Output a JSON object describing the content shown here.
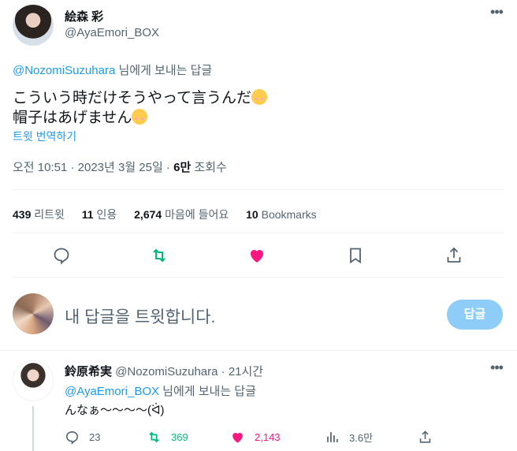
{
  "main_tweet": {
    "display_name": "絵森 彩",
    "handle": "@AyaEmori_BOX",
    "more_icon": "more-horizontal-icon",
    "replying_mention": "@NozomiSuzuhara",
    "replying_suffix": "님에게 보내는 답글",
    "text_line1": "こういう時だけそうやって言うんだ",
    "text_line2": "帽子はあげません",
    "emoji": "smiling-face-icon",
    "translate_label": "트윗 번역하기",
    "timestamp": "오전 10:51 · 2023년 3월 25일 · ",
    "views_count": "6만",
    "views_label": " 조회수"
  },
  "stats": {
    "retweets_count": "439",
    "retweets_label": " 리트윗",
    "quotes_count": "11",
    "quotes_label": " 인용",
    "likes_count": "2,674",
    "likes_label": " 마음에 들어요",
    "bookmarks_count": "10",
    "bookmarks_label": " Bookmarks"
  },
  "actions": {
    "reply_icon": "reply-icon",
    "retweet_icon": "retweet-icon",
    "like_icon": "heart-filled-icon",
    "bookmark_icon": "bookmark-icon",
    "share_icon": "share-icon"
  },
  "compose": {
    "placeholder": "내 답글을 트윗합니다.",
    "reply_button": "답글"
  },
  "reply_tweet": {
    "display_name": "鈴原希実",
    "handle": "@NozomiSuzuhara",
    "time": " · 21시간",
    "replying_mention": "@AyaEmori_BOX",
    "replying_suffix": "님에게 보내는 답글",
    "text": "んなぁ〜〜〜〜(ᐛ)",
    "reply_count": "23",
    "retweet_count": "369",
    "like_count": "2,143",
    "views_count": "3.6만"
  },
  "colors": {
    "accent": "#1d9bf0",
    "retweet_green": "#00ba7c",
    "like_pink": "#f91880",
    "muted_text": "#536471",
    "reply_button_disabled": "#8ecdf7"
  }
}
